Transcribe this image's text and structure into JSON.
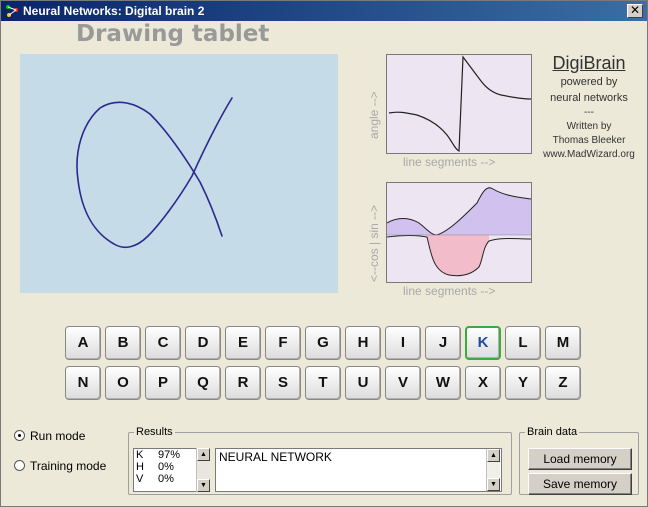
{
  "window": {
    "title": "Neural Networks: Digital brain 2",
    "close": "✕"
  },
  "tablet": {
    "title": "Drawing tablet"
  },
  "graphs": {
    "angle_label": "angle -->",
    "x_label": "line segments -->",
    "sincos_label": "<--cos | sin -->",
    "x_label2": "line segments -->"
  },
  "brand": {
    "name": "DigiBrain",
    "line1": "powered by",
    "line2": "neural networks",
    "line3": "---",
    "line4": "Written by",
    "line5": "Thomas Bleeker",
    "line6": "www.MadWizard.org"
  },
  "keys": {
    "row1": [
      "A",
      "B",
      "C",
      "D",
      "E",
      "F",
      "G",
      "H",
      "I",
      "J",
      "K",
      "L",
      "M"
    ],
    "row2": [
      "N",
      "O",
      "P",
      "Q",
      "R",
      "S",
      "T",
      "U",
      "V",
      "W",
      "X",
      "Y",
      "Z"
    ],
    "selected": "K"
  },
  "modes": {
    "run": "Run mode",
    "training": "Training mode",
    "selected": "run"
  },
  "results": {
    "legend": "Results",
    "scores": [
      {
        "letter": "K",
        "value": "97%"
      },
      {
        "letter": "H",
        "value": "0%"
      },
      {
        "letter": "V",
        "value": "0%"
      }
    ],
    "text": "NEURAL NETWORK"
  },
  "brain": {
    "legend": "Brain data",
    "load": "Load memory",
    "save": "Save memory"
  },
  "colors": {
    "stroke": "#2a2a8c",
    "tablet_bg": "#c5dbe8",
    "selected_key_border": "#3caa3c"
  }
}
